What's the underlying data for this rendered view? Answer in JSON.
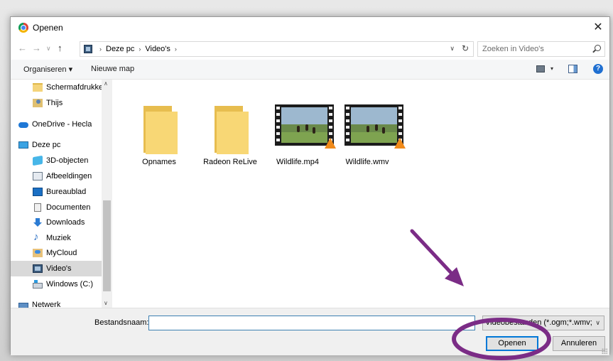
{
  "window": {
    "title": "Openen",
    "close_glyph": "✕"
  },
  "nav": {
    "back_glyph": "←",
    "forward_glyph": "→",
    "recent_glyph": "∨",
    "up_glyph": "↑",
    "breadcrumb": [
      "Deze pc",
      "Video's"
    ],
    "crumb_sep": "›",
    "dropdown_glyph": "∨",
    "refresh_glyph": "↻",
    "search_placeholder": "Zoeken in Video's"
  },
  "toolbar": {
    "organize_label": "Organiseren ▾",
    "new_folder_label": "Nieuwe map",
    "help_glyph": "?",
    "view_drop_glyph": "▾"
  },
  "sidebar": {
    "items": [
      {
        "label": "Schermafdrukken",
        "icon": "folder-icon"
      },
      {
        "label": "Thijs",
        "icon": "user-folder-icon"
      },
      {
        "label": "OneDrive - Hecla",
        "icon": "onedrive-icon"
      },
      {
        "label": "Deze pc",
        "icon": "pc-icon"
      },
      {
        "label": "3D-objecten",
        "icon": "3d-objects-icon"
      },
      {
        "label": "Afbeeldingen",
        "icon": "pictures-icon"
      },
      {
        "label": "Bureaublad",
        "icon": "desktop-icon"
      },
      {
        "label": "Documenten",
        "icon": "documents-icon"
      },
      {
        "label": "Downloads",
        "icon": "downloads-icon"
      },
      {
        "label": "Muziek",
        "icon": "music-icon"
      },
      {
        "label": "MyCloud",
        "icon": "mycloud-icon"
      },
      {
        "label": "Video's",
        "icon": "videos-icon",
        "selected": true
      },
      {
        "label": "Windows (C:)",
        "icon": "drive-icon"
      },
      {
        "label": "Netwerk",
        "icon": "network-icon"
      }
    ],
    "scroll_up_glyph": "∧",
    "scroll_down_glyph": "∨"
  },
  "files": [
    {
      "name": "Opnames",
      "type": "folder"
    },
    {
      "name": "Radeon ReLive",
      "type": "folder"
    },
    {
      "name": "Wildlife.mp4",
      "type": "video"
    },
    {
      "name": "Wildlife.wmv",
      "type": "video"
    }
  ],
  "bottom": {
    "filename_label": "Bestandsnaam:",
    "filename_value": "",
    "filter_value": "Videobestanden (*.ogm;*.wmv;",
    "filter_drop_glyph": "∨",
    "open_label": "Openen",
    "cancel_label": "Annuleren"
  },
  "annotation": {
    "color": "#7b2c86"
  }
}
